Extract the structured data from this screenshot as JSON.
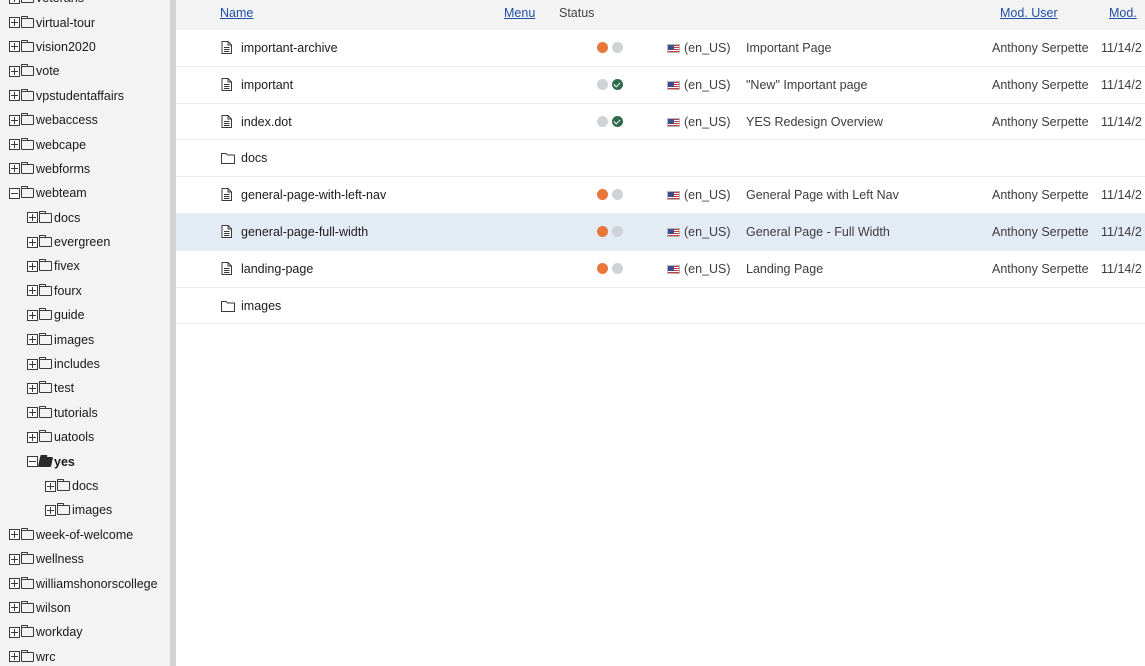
{
  "tree": [
    {
      "label": "veterans",
      "depth": 0,
      "expanded": false
    },
    {
      "label": "virtual-tour",
      "depth": 0,
      "expanded": false
    },
    {
      "label": "vision2020",
      "depth": 0,
      "expanded": false
    },
    {
      "label": "vote",
      "depth": 0,
      "expanded": false
    },
    {
      "label": "vpstudentaffairs",
      "depth": 0,
      "expanded": false
    },
    {
      "label": "webaccess",
      "depth": 0,
      "expanded": false
    },
    {
      "label": "webcape",
      "depth": 0,
      "expanded": false
    },
    {
      "label": "webforms",
      "depth": 0,
      "expanded": false
    },
    {
      "label": "webteam",
      "depth": 0,
      "expanded": true
    },
    {
      "label": "docs",
      "depth": 1,
      "expanded": false
    },
    {
      "label": "evergreen",
      "depth": 1,
      "expanded": false
    },
    {
      "label": "fivex",
      "depth": 1,
      "expanded": false
    },
    {
      "label": "fourx",
      "depth": 1,
      "expanded": false
    },
    {
      "label": "guide",
      "depth": 1,
      "expanded": false
    },
    {
      "label": "images",
      "depth": 1,
      "expanded": false
    },
    {
      "label": "includes",
      "depth": 1,
      "expanded": false
    },
    {
      "label": "test",
      "depth": 1,
      "expanded": false
    },
    {
      "label": "tutorials",
      "depth": 1,
      "expanded": false
    },
    {
      "label": "uatools",
      "depth": 1,
      "expanded": false
    },
    {
      "label": "yes",
      "depth": 1,
      "expanded": true,
      "open": true
    },
    {
      "label": "docs",
      "depth": 2,
      "expanded": false
    },
    {
      "label": "images",
      "depth": 2,
      "expanded": false
    },
    {
      "label": "week-of-welcome",
      "depth": 0,
      "expanded": false
    },
    {
      "label": "wellness",
      "depth": 0,
      "expanded": false
    },
    {
      "label": "williamshonorscollege",
      "depth": 0,
      "expanded": false
    },
    {
      "label": "wilson",
      "depth": 0,
      "expanded": false
    },
    {
      "label": "workday",
      "depth": 0,
      "expanded": false
    },
    {
      "label": "wrc",
      "depth": 0,
      "expanded": false
    }
  ],
  "columns": {
    "name": "Name",
    "menu": "Menu",
    "status": "Status",
    "mod_user": "Mod. User",
    "mod_date": "Mod."
  },
  "rows": [
    {
      "type": "page",
      "name": "important-archive",
      "status": [
        "orange",
        "grey"
      ],
      "lang": "(en_US)",
      "title": "Important Page",
      "user": "Anthony Serpette",
      "date": "11/14/2",
      "selected": false
    },
    {
      "type": "page",
      "name": "important",
      "status": [
        "grey",
        "check"
      ],
      "lang": "(en_US)",
      "title": "\"New\" Important page",
      "user": "Anthony Serpette",
      "date": "11/14/2",
      "selected": false
    },
    {
      "type": "page",
      "name": "index.dot",
      "status": [
        "grey",
        "check"
      ],
      "lang": "(en_US)",
      "title": "YES Redesign Overview",
      "user": "Anthony Serpette",
      "date": "11/14/2",
      "selected": false
    },
    {
      "type": "folder",
      "name": "docs",
      "selected": false
    },
    {
      "type": "page",
      "name": "general-page-with-left-nav",
      "status": [
        "orange",
        "grey"
      ],
      "lang": "(en_US)",
      "title": "General Page with Left Nav",
      "user": "Anthony Serpette",
      "date": "11/14/2",
      "selected": false
    },
    {
      "type": "page",
      "name": "general-page-full-width",
      "status": [
        "orange",
        "grey"
      ],
      "lang": "(en_US)",
      "title": "General Page - Full Width",
      "user": "Anthony Serpette",
      "date": "11/14/2",
      "selected": true
    },
    {
      "type": "page",
      "name": "landing-page",
      "status": [
        "orange",
        "grey"
      ],
      "lang": "(en_US)",
      "title": "Landing Page",
      "user": "Anthony Serpette",
      "date": "11/14/2",
      "selected": false
    },
    {
      "type": "folder",
      "name": "images",
      "selected": false
    }
  ],
  "colors": {
    "link": "#1f4fa8",
    "status_orange": "#e8773a",
    "status_grey": "#d0d3d6",
    "status_check": "#2e6b4c",
    "selected_row": "#e3ebf5"
  }
}
